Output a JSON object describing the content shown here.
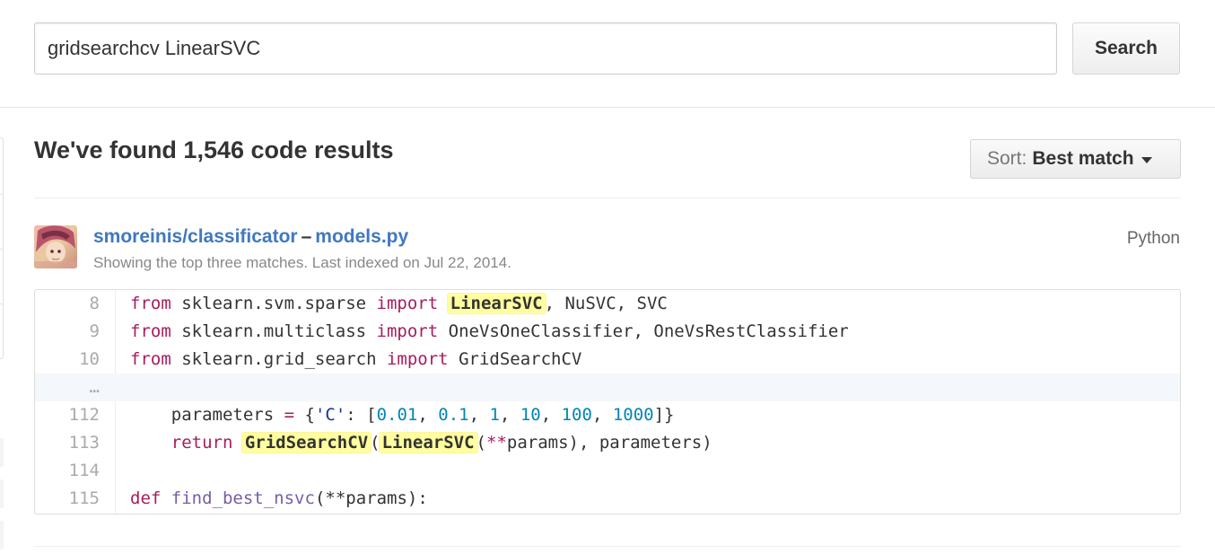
{
  "search": {
    "query": "gridsearchcv LinearSVC",
    "button_label": "Search"
  },
  "results": {
    "heading": "We've found 1,546 code results",
    "sort_label": "Sort:",
    "sort_value": "Best match"
  },
  "result": {
    "repo": "smoreinis/classificator",
    "separator": "–",
    "file": "models.py",
    "meta": "Showing the top three matches. Last indexed on Jul 22, 2014.",
    "language": "Python",
    "lines": [
      {
        "num": "8",
        "tokens": [
          {
            "t": "from",
            "c": "kw"
          },
          {
            "t": " sklearn.svm.sparse "
          },
          {
            "t": "import",
            "c": "kw"
          },
          {
            "t": " "
          },
          {
            "t": "LinearSVC",
            "c": "hl"
          },
          {
            "t": ", NuSVC, SVC"
          }
        ]
      },
      {
        "num": "9",
        "tokens": [
          {
            "t": "from",
            "c": "kw"
          },
          {
            "t": " sklearn.multiclass "
          },
          {
            "t": "import",
            "c": "kw"
          },
          {
            "t": " OneVsOneClassifier, OneVsRestClassifier"
          }
        ]
      },
      {
        "num": "10",
        "tokens": [
          {
            "t": "from",
            "c": "kw"
          },
          {
            "t": " sklearn.grid_search "
          },
          {
            "t": "import",
            "c": "kw"
          },
          {
            "t": " GridSearchCV"
          }
        ]
      },
      {
        "num": "…",
        "divider": true,
        "tokens": []
      },
      {
        "num": "112",
        "tokens": [
          {
            "t": "    parameters "
          },
          {
            "t": "=",
            "c": "kw"
          },
          {
            "t": " {"
          },
          {
            "t": "'C'",
            "c": "str"
          },
          {
            "t": ": ["
          },
          {
            "t": "0.01",
            "c": "num"
          },
          {
            "t": ", "
          },
          {
            "t": "0.1",
            "c": "num"
          },
          {
            "t": ", "
          },
          {
            "t": "1",
            "c": "num"
          },
          {
            "t": ", "
          },
          {
            "t": "10",
            "c": "num"
          },
          {
            "t": ", "
          },
          {
            "t": "100",
            "c": "num"
          },
          {
            "t": ", "
          },
          {
            "t": "1000",
            "c": "num"
          },
          {
            "t": "]}"
          }
        ]
      },
      {
        "num": "113",
        "tokens": [
          {
            "t": "    "
          },
          {
            "t": "return",
            "c": "kw"
          },
          {
            "t": " "
          },
          {
            "t": "GridSearchCV",
            "c": "hl"
          },
          {
            "t": "("
          },
          {
            "t": "LinearSVC",
            "c": "hl"
          },
          {
            "t": "("
          },
          {
            "t": "**",
            "c": "kw"
          },
          {
            "t": "params), parameters)"
          }
        ]
      },
      {
        "num": "114",
        "tokens": []
      },
      {
        "num": "115",
        "tokens": [
          {
            "t": "def",
            "c": "kw"
          },
          {
            "t": " "
          },
          {
            "t": "find_best_nsvc",
            "c": "fn"
          },
          {
            "t": "(**params):"
          }
        ]
      }
    ]
  }
}
